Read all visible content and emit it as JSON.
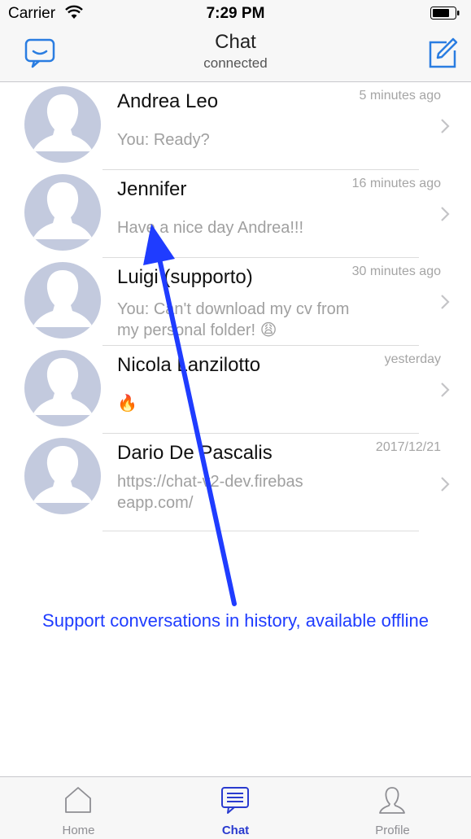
{
  "status_bar": {
    "carrier": "Carrier",
    "time": "7:29 PM"
  },
  "nav": {
    "title": "Chat",
    "subtitle": "connected",
    "left_icon": "chat-bubble-icon",
    "right_icon": "compose-icon"
  },
  "conversations": [
    {
      "name": "Andrea Leo",
      "time": "5 minutes ago",
      "message": "You: Ready?"
    },
    {
      "name": "Jennifer",
      "time": "16 minutes ago",
      "message": "Have a nice day Andrea!!!"
    },
    {
      "name": "Luigi (supporto)",
      "time": "30 minutes ago",
      "message": "You: Can't download my cv from my personal folder! 😩"
    },
    {
      "name": "Nicola Lanzilotto",
      "time": "yesterday",
      "message": "🔥"
    },
    {
      "name": "Dario De Pascalis",
      "time": "2017/12/21",
      "message": "https://chat-v2-dev.firebaseapp.com/"
    }
  ],
  "annotation": {
    "text": "Support conversations in history, available offline",
    "color": "#1f3cff"
  },
  "tabs": [
    {
      "label": "Home",
      "icon": "home-icon",
      "active": false
    },
    {
      "label": "Chat",
      "icon": "chat-icon",
      "active": true
    },
    {
      "label": "Profile",
      "icon": "profile-icon",
      "active": false
    }
  ],
  "colors": {
    "accent": "#2a3bcf",
    "avatar": "#c3cade",
    "secondary_text": "#a0a0a0"
  }
}
